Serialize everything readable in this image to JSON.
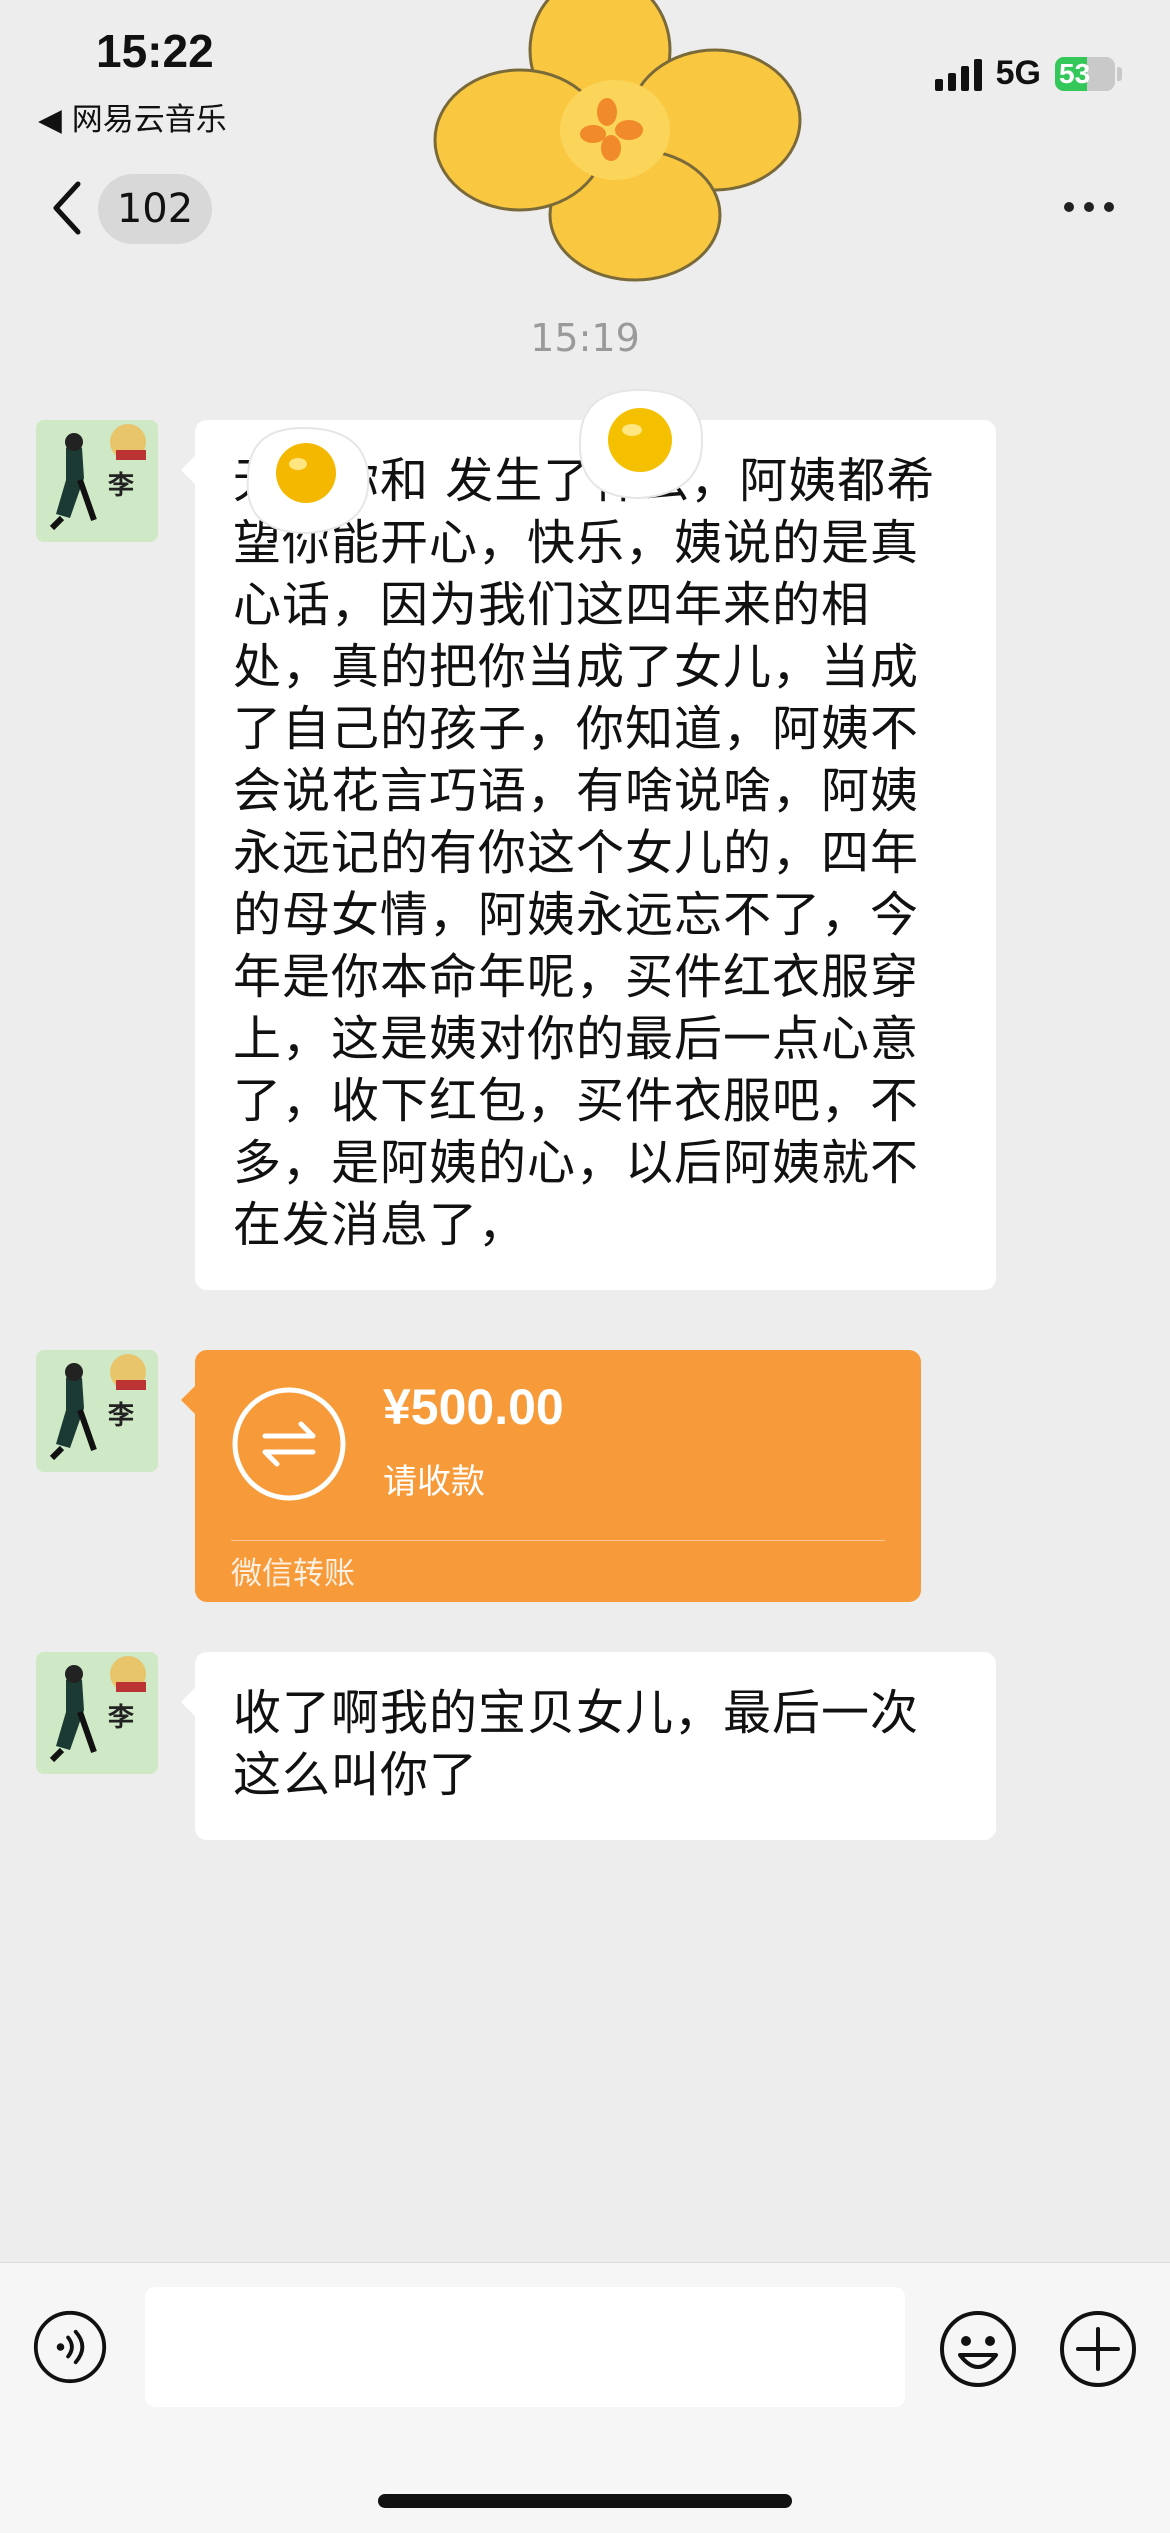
{
  "status_bar": {
    "time": "15:22",
    "back_app": "◀ 网易云音乐",
    "network": "5G",
    "battery": "53",
    "battery_level": 0.53
  },
  "nav": {
    "unread_count": "102"
  },
  "chat": {
    "timestamp": "15:19",
    "messages": [
      {
        "type": "text",
        "text": "无论你和 发生了什么，阿姨都希望你能开心，快乐，姨说的是真心话，因为我们这四年来的相处，真的把你当成了女儿，当成了自己的孩子，你知道，阿姨不会说花言巧语，有啥说啥，阿姨永远记的有你这个女儿的，四年的母女情，阿姨永远忘不了，今年是你本命年呢，买件红衣服穿上，这是姨对你的最后一点心意了，收下红包，买件衣服吧，不多，是阿姨的心，以后阿姨就不在发消息了，"
      },
      {
        "type": "transfer",
        "amount": "¥500.00",
        "status": "请收款",
        "footer": "微信转账"
      },
      {
        "type": "text",
        "text": "收了啊我的宝贝女儿，最后一次这么叫你了"
      }
    ],
    "avatar_label": "李"
  },
  "colors": {
    "background": "#ededed",
    "transfer": "#f79a3a",
    "battery": "#34c759"
  }
}
